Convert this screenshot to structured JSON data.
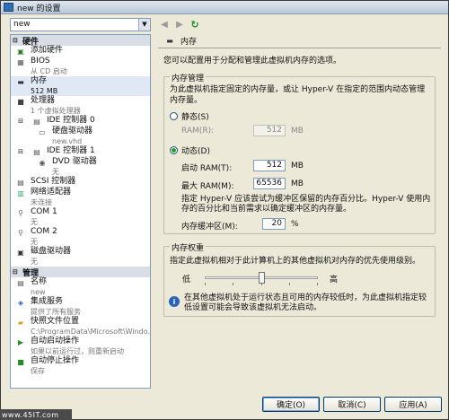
{
  "window": {
    "title": "new 的设置",
    "vm_name": "new"
  },
  "tree": {
    "hardware_section": "硬件",
    "management_section": "管理",
    "hardware": [
      {
        "label": "添加硬件",
        "sub": ""
      },
      {
        "label": "BIOS",
        "sub": "从 CD 启动"
      },
      {
        "label": "内存",
        "sub": "512 MB"
      },
      {
        "label": "处理器",
        "sub": "1 个虚拟处理器"
      },
      {
        "label": "IDE 控制器 0",
        "sub": ""
      },
      {
        "label": "硬盘驱动器",
        "sub": "new.vhd"
      },
      {
        "label": "IDE 控制器 1",
        "sub": ""
      },
      {
        "label": "DVD 驱动器",
        "sub": "无"
      },
      {
        "label": "SCSI 控制器",
        "sub": ""
      },
      {
        "label": "网络适配器",
        "sub": "未连接"
      },
      {
        "label": "COM 1",
        "sub": "无"
      },
      {
        "label": "COM 2",
        "sub": "无"
      },
      {
        "label": "磁盘驱动器",
        "sub": "无"
      }
    ],
    "management": [
      {
        "label": "名称",
        "sub": "new"
      },
      {
        "label": "集成服务",
        "sub": "提供了所有服务"
      },
      {
        "label": "快照文件位置",
        "sub": "C:\\ProgramData\\Microsoft\\Windo..."
      },
      {
        "label": "自动启动操作",
        "sub": "如果以前运行过，则重新启动"
      },
      {
        "label": "自动停止操作",
        "sub": "保存"
      }
    ]
  },
  "panel": {
    "title": "内存",
    "description": "您可以配置用于分配和管理此虚拟机内存的选项。",
    "mgmt_group": "内存管理",
    "mgmt_desc": "为此虚拟机指定固定的内存量，或让 Hyper-V 在指定的范围内动态管理内存量。",
    "static_label": "静态(S)",
    "ram_label": "RAM(R):",
    "ram_value": "512",
    "dynamic_label": "动态(D)",
    "startup_label": "启动 RAM(T):",
    "startup_value": "512",
    "max_label": "最大 RAM(M):",
    "max_value": "65536",
    "unit_mb": "MB",
    "buffer_desc": "指定 Hyper-V 应该尝试为缓冲区保留的内存百分比。Hyper-V 使用内存的百分比和当前需求以确定缓冲区的内存量。",
    "buffer_label": "内存缓冲区(M):",
    "buffer_value": "20",
    "buffer_unit": "%",
    "weight_group": "内存权重",
    "weight_desc": "指定此虚拟机相对于此计算机上的其他虚拟机对内存的优先使用级别。",
    "low_label": "低",
    "high_label": "高",
    "weight_level": 0.5,
    "info_text": "在其他虚拟机处于运行状态且可用的内存较低时，为此虚拟机指定较低设置可能会导致该虚拟机无法启动。"
  },
  "buttons": {
    "ok": "确定(O)",
    "cancel": "取消(C)",
    "apply": "应用(A)"
  },
  "watermark": "www.45IT.com"
}
